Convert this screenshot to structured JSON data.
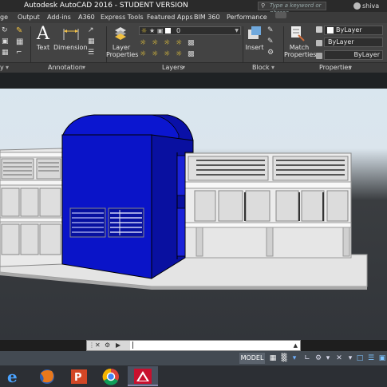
{
  "titlebar": {
    "title": "Autodesk AutoCAD 2016 - STUDENT VERSION",
    "search_placeholder": "Type a keyword or phrase",
    "user": "shiva"
  },
  "tabs": [
    "ge",
    "Output",
    "Add-ins",
    "A360",
    "Express Tools",
    "Featured Apps",
    "BIM 360",
    "Performance"
  ],
  "ribbon": {
    "text_label": "Text",
    "dimension_label": "Dimension",
    "layer_properties_label": "Layer\nProperties",
    "layer_dropdown_value": "0",
    "insert_label": "Insert",
    "match_properties_label": "Match\nProperties",
    "bylayer_1": "ByLayer",
    "bylayer_2": "ByLayer",
    "bylayer_3": "ByLayer",
    "panels": [
      "y",
      "Annotation",
      "Layers",
      "Block",
      "Properties"
    ]
  },
  "commandline": {
    "input_value": "|"
  },
  "statusbar": {
    "model_label": "MODEL"
  },
  "colors": {
    "blue_object": "#0a14c8",
    "title_bar": "#2a2a2a",
    "ribbon": "#434343"
  },
  "taskbar": {
    "items": [
      "internet-explorer-icon",
      "firefox-icon",
      "powerpoint-icon",
      "chrome-icon",
      "autocad-icon"
    ]
  }
}
